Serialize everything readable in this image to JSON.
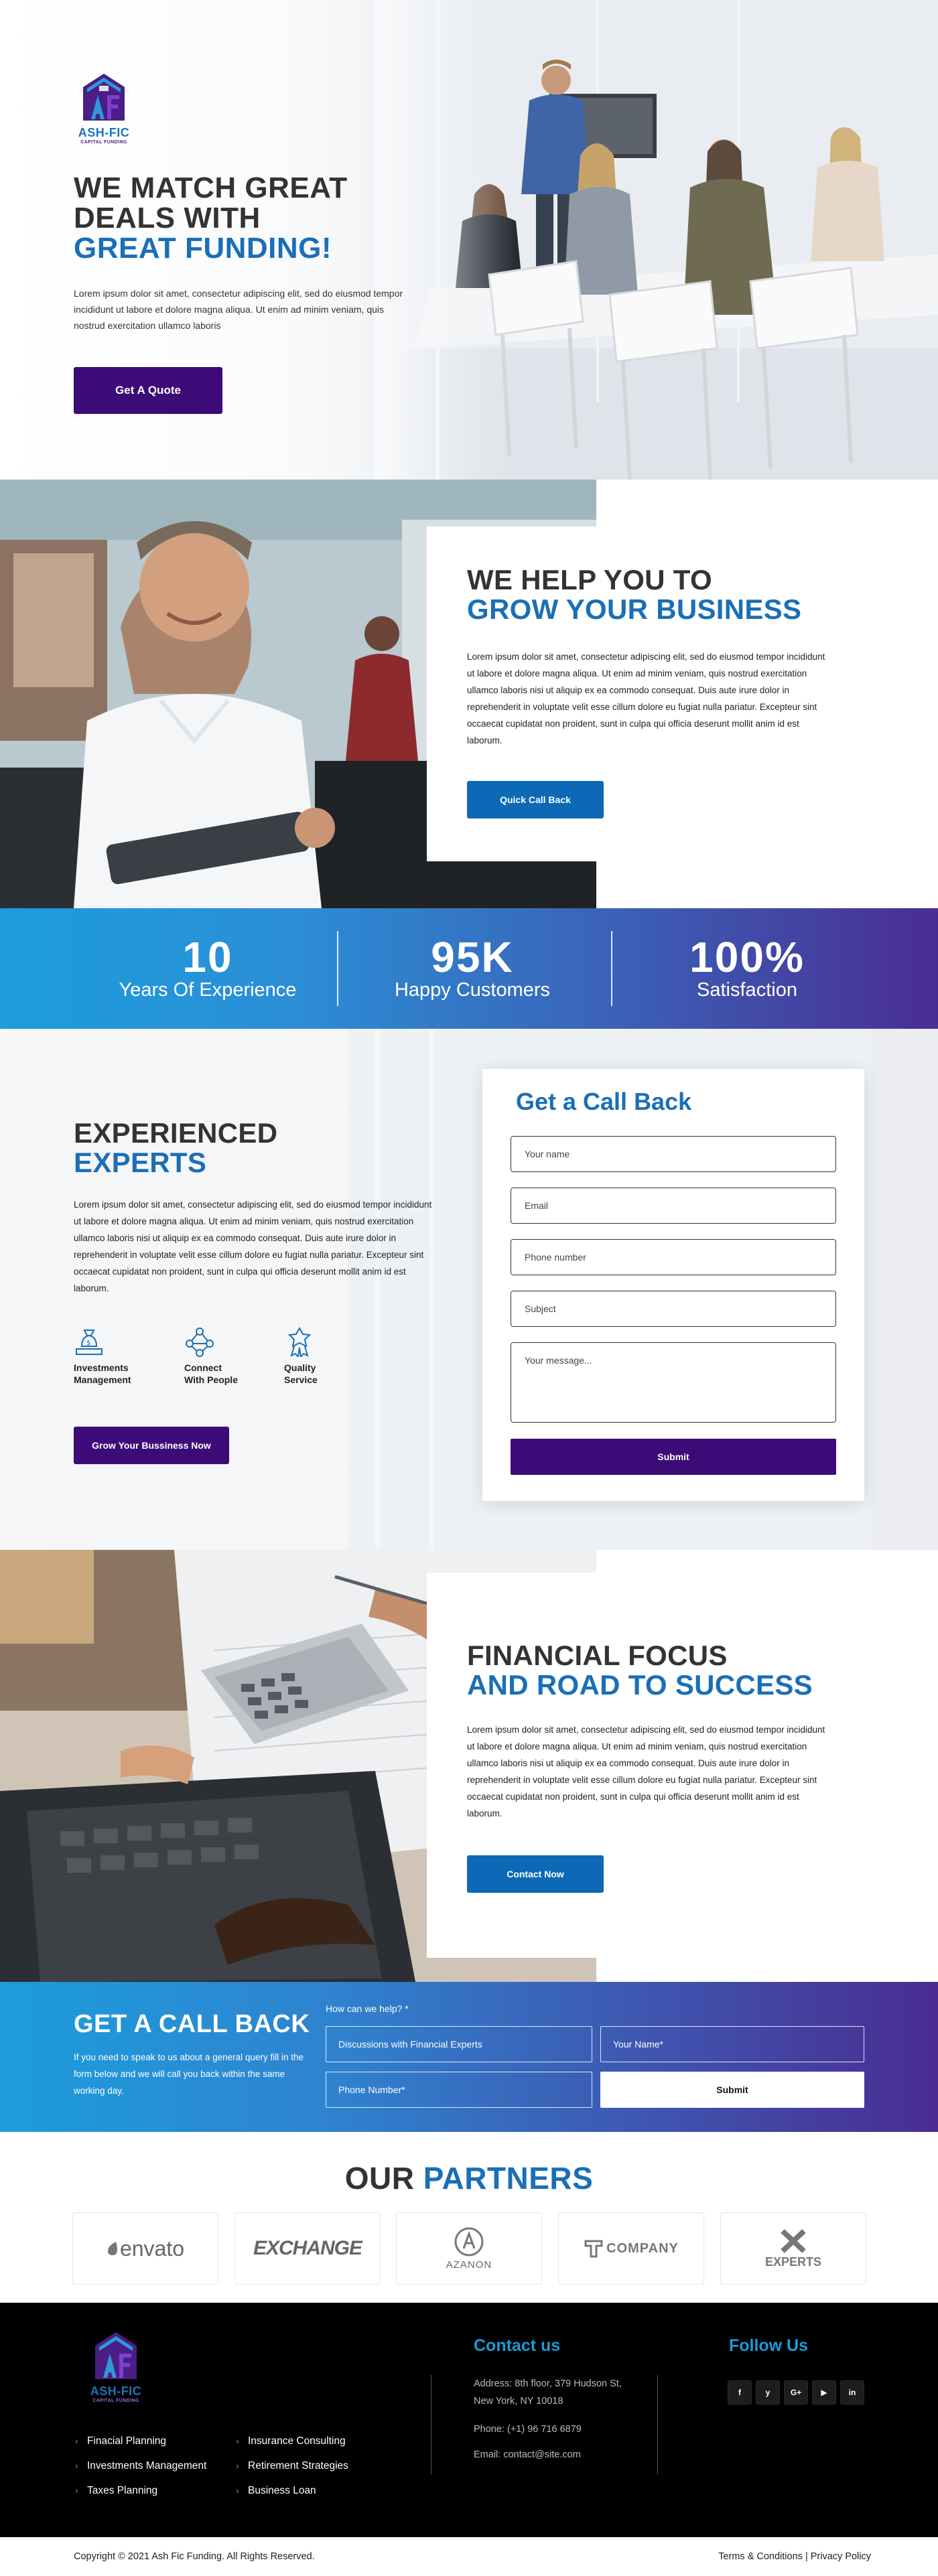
{
  "brand": {
    "name": "ASH-FIC",
    "tagline": "CAPITAL FUNDING",
    "colors": {
      "primary_blue": "#1a6fb6",
      "purple": "#3c0b78",
      "gradient_start": "#1c9ddc",
      "gradient_end": "#4a2c92"
    }
  },
  "hero": {
    "title_line1": "WE MATCH GREAT",
    "title_line2": "DEALS WITH",
    "title_accent": "GREAT FUNDING!",
    "text": "Lorem ipsum dolor sit amet, consectetur adipiscing elit, sed do eiusmod tempor incididunt ut labore et dolore magna aliqua. Ut enim ad minim veniam, quis nostrud exercitation ullamco laboris",
    "cta": "Get A Quote"
  },
  "help": {
    "title_line1": "WE HELP YOU TO",
    "title_accent": "GROW YOUR BUSINESS",
    "text": "Lorem ipsum dolor sit amet, consectetur adipiscing elit, sed do eiusmod tempor incididunt ut labore et dolore magna aliqua. Ut enim ad minim veniam, quis nostrud exercitation ullamco laboris nisi ut aliquip ex ea commodo consequat. Duis aute irure dolor in reprehenderit in voluptate velit esse cillum dolore eu fugiat nulla pariatur. Excepteur sint occaecat cupidatat non proident, sunt in culpa qui officia deserunt mollit anim id est laborum.",
    "cta": "Quick Call Back"
  },
  "stats": [
    {
      "value": "10",
      "label": "Years Of Experience"
    },
    {
      "value": "95K",
      "label": "Happy Customers"
    },
    {
      "value": "100%",
      "label": "Satisfaction"
    }
  ],
  "experts": {
    "title_line1": "EXPERIENCED",
    "title_accent": "EXPERTS",
    "text": "Lorem ipsum dolor sit amet, consectetur adipiscing elit, sed do eiusmod tempor incididunt ut labore et dolore magna aliqua. Ut enim ad minim veniam, quis nostrud exercitation ullamco laboris nisi ut aliquip ex ea commodo consequat. Duis aute irure dolor in reprehenderit in voluptate velit esse cillum dolore eu fugiat nulla pariatur. Excepteur sint occaecat cupidatat non proident, sunt in culpa qui officia deserunt mollit anim id est laborum.",
    "features": [
      {
        "line1": "Investments",
        "line2": "Management",
        "icon": "money-bag-icon"
      },
      {
        "line1": "Connect",
        "line2": "With People",
        "icon": "people-network-icon"
      },
      {
        "line1": "Quality",
        "line2": "Service",
        "icon": "award-icon"
      }
    ],
    "cta": "Grow Your Bussiness Now"
  },
  "callback_form": {
    "title": "Get a Call Back",
    "name_placeholder": "Your name",
    "email_placeholder": "Email",
    "phone_placeholder": "Phone number",
    "subject_placeholder": "Subject",
    "message_placeholder": "Your message...",
    "submit": "Submit"
  },
  "financial": {
    "title_line1": "FINANCIAL FOCUS",
    "title_accent": "AND ROAD TO SUCCESS",
    "text": "Lorem ipsum dolor sit amet, consectetur adipiscing elit, sed do eiusmod tempor incididunt ut labore et dolore magna aliqua. Ut enim ad minim veniam, quis nostrud exercitation ullamco laboris nisi ut aliquip ex ea commodo consequat. Duis aute irure dolor in reprehenderit in voluptate velit esse cillum dolore eu fugiat nulla pariatur. Excepteur sint occaecat cupidatat non proident, sunt in culpa qui officia deserunt mollit anim id est laborum.",
    "cta": "Contact Now"
  },
  "callback_band": {
    "title": "GET A CALL BACK",
    "text": "If you need to speak to us about a general query fill in the form below and we will call you back within the same working day.",
    "question": "How can we help? *",
    "select_value": "Discussions with Financial Experts",
    "name_placeholder": "Your Name*",
    "phone_placeholder": "Phone Number*",
    "submit": "Submit"
  },
  "partners": {
    "title": "OUR",
    "title_accent": "PARTNERS",
    "logos": [
      "envato",
      "EXCHANGE",
      "AZANON",
      "COMPANY",
      "EXPERTS"
    ]
  },
  "footer": {
    "links_col1": [
      "Finacial Planning",
      "Investments Management",
      "Taxes Planning"
    ],
    "links_col2": [
      "Insurance Consulting",
      "Retirement Strategies",
      "Business Loan"
    ],
    "contact_title": "Contact us",
    "address_line1": "Address: 8th floor, 379 Hudson St,",
    "address_line2": "New York, NY 10018",
    "phone": "Phone: (+1) 96 716 6879",
    "email": "Email: contact@site.com",
    "follow_title": "Follow Us",
    "socials": [
      "f",
      "y",
      "G+",
      "▶",
      "in"
    ],
    "copyright": "Copyright © 2021 Ash Fic Funding. All Rights Reserved.",
    "terms": "Terms & Conditions",
    "separator": "|",
    "privacy": "Privacy Policy"
  }
}
